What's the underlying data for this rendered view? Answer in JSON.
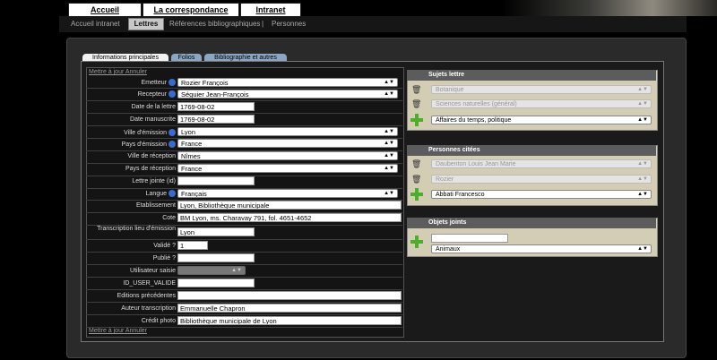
{
  "topnav": {
    "tabs": [
      {
        "label": "Accueil"
      },
      {
        "label": "La correspondance"
      },
      {
        "label": "Intranet"
      }
    ]
  },
  "subnav": {
    "items": [
      {
        "label": "Accueil intranet"
      },
      {
        "label": "Lettres"
      },
      {
        "label": "Références bibliographiques"
      },
      {
        "label": "|"
      },
      {
        "label": "Personnes"
      }
    ]
  },
  "form_tabs": [
    {
      "label": "Informations principales"
    },
    {
      "label": "Folios"
    },
    {
      "label": "Bibliographie et autres"
    }
  ],
  "form": {
    "top_link": "Mettre à jour Annuler",
    "bottom_link": "Mettre à jour Annuler",
    "fields": [
      {
        "label": "Emetteur",
        "value": "Rozier François"
      },
      {
        "label": "Recepteur",
        "value": "Séguier Jean-François"
      },
      {
        "label": "Date de la lettre",
        "value": "1769-08-02"
      },
      {
        "label": "Date manuscrite",
        "value": "1769-08-02"
      },
      {
        "label": "Ville d'émission",
        "value": "Lyon"
      },
      {
        "label": "Pays d'émission",
        "value": "France"
      },
      {
        "label": "Ville de réception",
        "value": "Nîmes"
      },
      {
        "label": "Pays de réception",
        "value": "France"
      },
      {
        "label": "Lettre jointe (id)",
        "value": ""
      },
      {
        "label": "Langue",
        "value": "Français"
      },
      {
        "label": "Etablissement",
        "value": "Lyon, Bibliothèque municipale"
      },
      {
        "label": "Cote",
        "value": "BM Lyon, ms. Charavay 791, fol. 4651-4652"
      },
      {
        "label": "Transcription lieu d'émission",
        "value": "Lyon"
      },
      {
        "label": "Validé ?",
        "value": "1"
      },
      {
        "label": "Publié ?",
        "value": ""
      },
      {
        "label": "Utilisateur saisie",
        "value": ""
      },
      {
        "label": "ID_USER_VALIDE",
        "value": ""
      },
      {
        "label": "Editions précédentes",
        "value": ""
      },
      {
        "label": "Auteur transcription",
        "value": "Emmanuelle Chapron"
      },
      {
        "label": "Crédit photo",
        "value": "Bibliothèque municipale de Lyon"
      }
    ]
  },
  "sujets": {
    "title": "Sujets lettre",
    "items": [
      "Botanique",
      "Sciences naturelles (général)"
    ],
    "new_value": "Affaires du temps, politique"
  },
  "personnes": {
    "title": "Personnes citées",
    "items": [
      "Daubenton Louis Jean Marie",
      "Rozier"
    ],
    "new_value": "Abbati Francesco"
  },
  "objets": {
    "title": "Objets joints",
    "input_value": "",
    "select_value": "Animaux"
  },
  "colors": {
    "panel": "#2a2a2a",
    "side_box": "#d2cdb3",
    "side_header": "#5c5c5c",
    "add_green": "#4caf2a"
  }
}
